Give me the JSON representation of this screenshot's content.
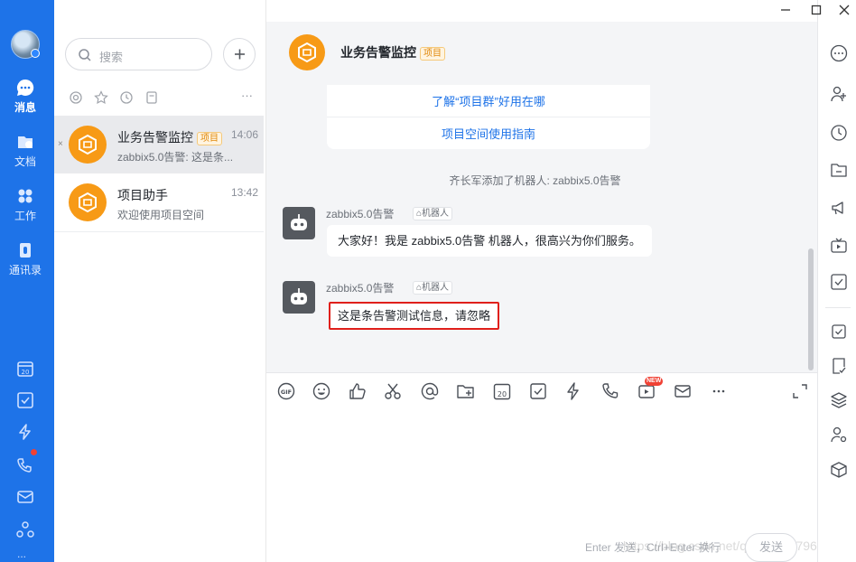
{
  "rail": {
    "items": [
      {
        "label": "消息"
      },
      {
        "label": "文档"
      },
      {
        "label": "工作"
      },
      {
        "label": "通讯录"
      }
    ],
    "more": "..."
  },
  "list": {
    "search_placeholder": "搜索",
    "more": "···",
    "conversations": [
      {
        "name": "业务告警监控",
        "tag": "项目",
        "time": "14:06",
        "preview": "zabbix5.0告警: 这是条..."
      },
      {
        "name": "项目助手",
        "time": "13:42",
        "preview": "欢迎使用项目空间"
      }
    ]
  },
  "chat": {
    "title": "业务告警监控",
    "title_tag": "项目",
    "card_links": [
      "了解“项目群”好用在哪",
      "项目空间使用指南"
    ],
    "system_message": "齐长军添加了机器人: zabbix5.0告警",
    "messages": [
      {
        "sender": "zabbix5.0告警",
        "badge": "机器人",
        "text": "大家好！我是 zabbix5.0告警 机器人，很高兴为你们服务。"
      },
      {
        "sender": "zabbix5.0告警",
        "badge": "机器人",
        "text": "这是条告警测试信息，请忽略"
      }
    ]
  },
  "composer": {
    "new_badge": "NEW",
    "hint": "Enter 发送，Ctrl+Enter 换行",
    "send_label": "发送",
    "watermark": "https://blog.csdn.net/qq_40166796"
  },
  "colors": {
    "brand": "#1e73e8",
    "orange": "#f79a16",
    "highlight": "#e0201b"
  }
}
